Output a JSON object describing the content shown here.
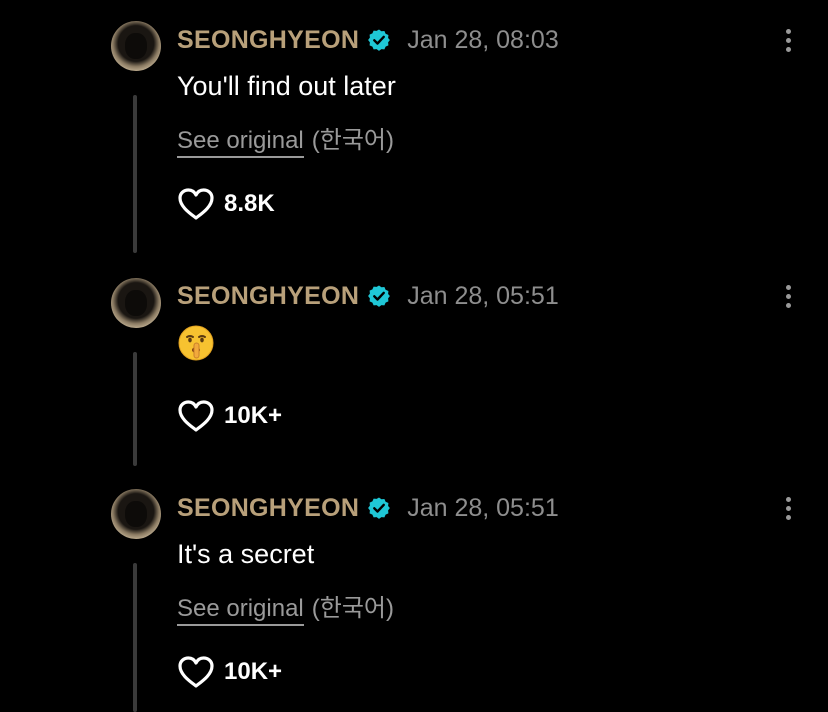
{
  "posts": [
    {
      "username": "SEONGHYEON",
      "timestamp": "Jan 28, 08:03",
      "text": "You'll find out later",
      "see_original": "See original",
      "language": "(한국어)",
      "likes": "8.8K"
    },
    {
      "username": "SEONGHYEON",
      "timestamp": "Jan 28, 05:51",
      "emoji": "shushing-face",
      "likes": "10K+"
    },
    {
      "username": "SEONGHYEON",
      "timestamp": "Jan 28, 05:51",
      "text": "It's a secret",
      "see_original": "See original",
      "language": "(한국어)",
      "likes": "10K+"
    }
  ],
  "colors": {
    "background": "#000000",
    "username": "#b8a07a",
    "timestamp": "#8e8e8e",
    "verified": "#1fc7d6",
    "text": "#ffffff",
    "thread_line": "#3a3a3a"
  }
}
